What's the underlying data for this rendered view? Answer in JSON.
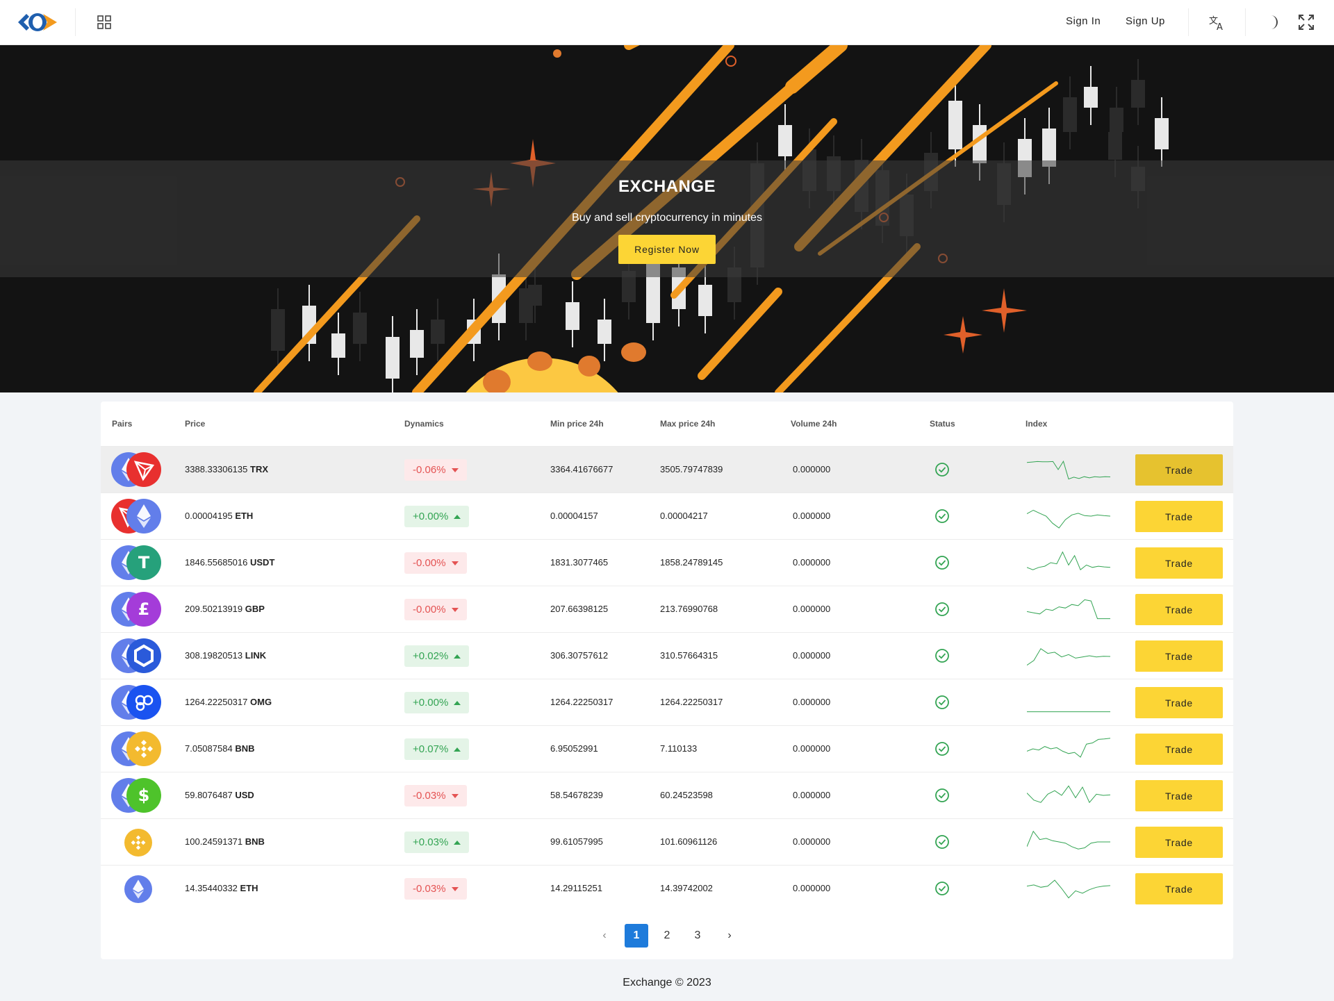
{
  "header": {
    "sign_in": "Sign In",
    "sign_up": "Sign Up",
    "icons": [
      "logo-icon",
      "apps-grid-icon",
      "translate-icon",
      "moon-icon",
      "fullscreen-icon"
    ]
  },
  "hero": {
    "title": "EXCHANGE",
    "subtitle": "Buy and sell cryptocurrency in minutes",
    "cta": "Register Now"
  },
  "table": {
    "headers": [
      "Pairs",
      "Price",
      "Dynamics",
      "Min price 24h",
      "Max price 24h",
      "Volume 24h",
      "Status",
      "Index"
    ],
    "trade_label": "Trade",
    "rows": [
      {
        "price": "3388.33306135",
        "symbol": "TRX",
        "dynamics": "-0.06%",
        "dir": "neg",
        "min": "3364.41676677",
        "max": "3505.79747839",
        "volume": "0.000000",
        "coins": [
          "eth",
          "trx"
        ],
        "spark": [
          0.8,
          0.82,
          0.84,
          0.83,
          0.83,
          0.84,
          0.5,
          0.85,
          0.1,
          0.18,
          0.12,
          0.2,
          0.15,
          0.2,
          0.18,
          0.2,
          0.19
        ],
        "highlight": true
      },
      {
        "price": "0.00004195",
        "symbol": "ETH",
        "dynamics": "+0.00%",
        "dir": "pos",
        "min": "0.00004157",
        "max": "0.00004217",
        "volume": "0.000000",
        "coins": [
          "trx",
          "eth"
        ],
        "spark": [
          0.6,
          0.75,
          0.62,
          0.5,
          0.2,
          0.0,
          0.35,
          0.55,
          0.62,
          0.52,
          0.5,
          0.55,
          0.52,
          0.5
        ],
        "highlight": false
      },
      {
        "price": "1846.55685016",
        "symbol": "USDT",
        "dynamics": "-0.00%",
        "dir": "neg",
        "min": "1831.3077465",
        "max": "1858.24789145",
        "volume": "0.000000",
        "coins": [
          "eth",
          "usdt"
        ],
        "spark": [
          0.3,
          0.2,
          0.3,
          0.35,
          0.5,
          0.45,
          0.95,
          0.4,
          0.8,
          0.2,
          0.4,
          0.3,
          0.35,
          0.32,
          0.3
        ],
        "highlight": false
      },
      {
        "price": "209.50213919",
        "symbol": "GBP",
        "dynamics": "-0.00%",
        "dir": "neg",
        "min": "207.66398125",
        "max": "213.76990768",
        "volume": "0.000000",
        "coins": [
          "eth",
          "gbp"
        ],
        "spark": [
          0.4,
          0.35,
          0.3,
          0.5,
          0.45,
          0.6,
          0.55,
          0.7,
          0.65,
          0.9,
          0.85,
          0.1,
          0.1,
          0.1
        ],
        "highlight": false
      },
      {
        "price": "308.19820513",
        "symbol": "LINK",
        "dynamics": "+0.02%",
        "dir": "pos",
        "min": "306.30757612",
        "max": "310.57664315",
        "volume": "0.000000",
        "coins": [
          "eth",
          "link"
        ],
        "spark": [
          0.1,
          0.3,
          0.8,
          0.6,
          0.65,
          0.45,
          0.55,
          0.4,
          0.45,
          0.5,
          0.45,
          0.48,
          0.47
        ],
        "highlight": false
      },
      {
        "price": "1264.22250317",
        "symbol": "OMG",
        "dynamics": "+0.00%",
        "dir": "pos",
        "min": "1264.22250317",
        "max": "1264.22250317",
        "volume": "0.000000",
        "coins": [
          "eth",
          "omg"
        ],
        "spark": [
          0.1,
          0.1,
          0.1,
          0.1,
          0.1,
          0.1,
          0.1,
          0.1
        ],
        "highlight": false
      },
      {
        "price": "7.05087584",
        "symbol": "BNB",
        "dynamics": "+0.07%",
        "dir": "pos",
        "min": "6.95052991",
        "max": "7.110133",
        "volume": "0.000000",
        "coins": [
          "eth",
          "bnb"
        ],
        "spark": [
          0.4,
          0.5,
          0.45,
          0.6,
          0.5,
          0.55,
          0.4,
          0.3,
          0.35,
          0.15,
          0.7,
          0.75,
          0.9,
          0.92,
          0.95
        ],
        "highlight": false
      },
      {
        "price": "59.8076487",
        "symbol": "USD",
        "dynamics": "-0.03%",
        "dir": "neg",
        "min": "58.54678239",
        "max": "60.24523598",
        "volume": "0.000000",
        "coins": [
          "eth",
          "usd"
        ],
        "spark": [
          0.6,
          0.3,
          0.2,
          0.55,
          0.7,
          0.5,
          0.9,
          0.4,
          0.85,
          0.2,
          0.55,
          0.5,
          0.52
        ],
        "highlight": false
      },
      {
        "price": "100.24591371",
        "symbol": "BNB",
        "dynamics": "+0.03%",
        "dir": "pos",
        "min": "99.61057995",
        "max": "101.60961126",
        "volume": "0.000000",
        "coins": [
          "bnb"
        ],
        "spark": [
          0.3,
          0.95,
          0.6,
          0.65,
          0.55,
          0.5,
          0.45,
          0.3,
          0.2,
          0.25,
          0.45,
          0.5,
          0.5,
          0.5
        ],
        "highlight": false
      },
      {
        "price": "14.35440332",
        "symbol": "ETH",
        "dynamics": "-0.03%",
        "dir": "neg",
        "min": "14.29115251",
        "max": "14.39742002",
        "volume": "0.000000",
        "coins": [
          "eth"
        ],
        "spark": [
          0.6,
          0.65,
          0.55,
          0.6,
          0.85,
          0.5,
          0.1,
          0.4,
          0.3,
          0.45,
          0.55,
          0.6,
          0.62
        ],
        "highlight": false
      }
    ]
  },
  "pagination": {
    "prev": "‹",
    "pages": [
      "1",
      "2",
      "3"
    ],
    "next": "›",
    "active": "1"
  },
  "footer": {
    "text": "Exchange © 2023"
  },
  "colors": {
    "accent": "#fcd535",
    "positive": "#33a453",
    "negative": "#e45353",
    "page_active": "#1e7bdb"
  }
}
